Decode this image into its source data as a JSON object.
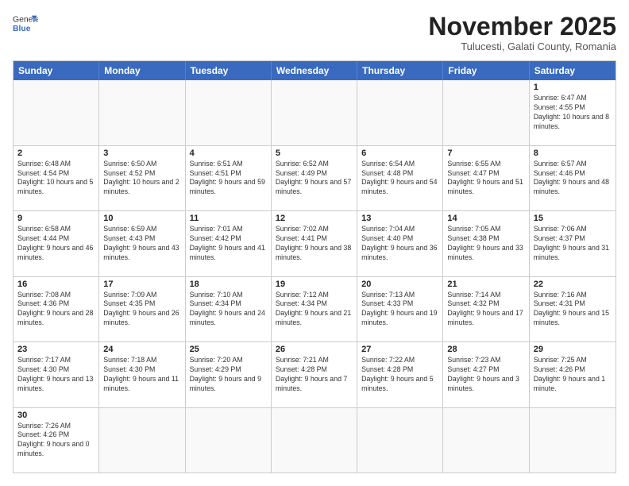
{
  "header": {
    "logo_general": "General",
    "logo_blue": "Blue",
    "month_title": "November 2025",
    "subtitle": "Tulucesti, Galati County, Romania"
  },
  "calendar": {
    "days": [
      "Sunday",
      "Monday",
      "Tuesday",
      "Wednesday",
      "Thursday",
      "Friday",
      "Saturday"
    ],
    "rows": [
      [
        {
          "day": "",
          "text": ""
        },
        {
          "day": "",
          "text": ""
        },
        {
          "day": "",
          "text": ""
        },
        {
          "day": "",
          "text": ""
        },
        {
          "day": "",
          "text": ""
        },
        {
          "day": "",
          "text": ""
        },
        {
          "day": "1",
          "text": "Sunrise: 6:47 AM\nSunset: 4:55 PM\nDaylight: 10 hours and 8 minutes."
        }
      ],
      [
        {
          "day": "2",
          "text": "Sunrise: 6:48 AM\nSunset: 4:54 PM\nDaylight: 10 hours and 5 minutes."
        },
        {
          "day": "3",
          "text": "Sunrise: 6:50 AM\nSunset: 4:52 PM\nDaylight: 10 hours and 2 minutes."
        },
        {
          "day": "4",
          "text": "Sunrise: 6:51 AM\nSunset: 4:51 PM\nDaylight: 9 hours and 59 minutes."
        },
        {
          "day": "5",
          "text": "Sunrise: 6:52 AM\nSunset: 4:49 PM\nDaylight: 9 hours and 57 minutes."
        },
        {
          "day": "6",
          "text": "Sunrise: 6:54 AM\nSunset: 4:48 PM\nDaylight: 9 hours and 54 minutes."
        },
        {
          "day": "7",
          "text": "Sunrise: 6:55 AM\nSunset: 4:47 PM\nDaylight: 9 hours and 51 minutes."
        },
        {
          "day": "8",
          "text": "Sunrise: 6:57 AM\nSunset: 4:46 PM\nDaylight: 9 hours and 48 minutes."
        }
      ],
      [
        {
          "day": "9",
          "text": "Sunrise: 6:58 AM\nSunset: 4:44 PM\nDaylight: 9 hours and 46 minutes."
        },
        {
          "day": "10",
          "text": "Sunrise: 6:59 AM\nSunset: 4:43 PM\nDaylight: 9 hours and 43 minutes."
        },
        {
          "day": "11",
          "text": "Sunrise: 7:01 AM\nSunset: 4:42 PM\nDaylight: 9 hours and 41 minutes."
        },
        {
          "day": "12",
          "text": "Sunrise: 7:02 AM\nSunset: 4:41 PM\nDaylight: 9 hours and 38 minutes."
        },
        {
          "day": "13",
          "text": "Sunrise: 7:04 AM\nSunset: 4:40 PM\nDaylight: 9 hours and 36 minutes."
        },
        {
          "day": "14",
          "text": "Sunrise: 7:05 AM\nSunset: 4:38 PM\nDaylight: 9 hours and 33 minutes."
        },
        {
          "day": "15",
          "text": "Sunrise: 7:06 AM\nSunset: 4:37 PM\nDaylight: 9 hours and 31 minutes."
        }
      ],
      [
        {
          "day": "16",
          "text": "Sunrise: 7:08 AM\nSunset: 4:36 PM\nDaylight: 9 hours and 28 minutes."
        },
        {
          "day": "17",
          "text": "Sunrise: 7:09 AM\nSunset: 4:35 PM\nDaylight: 9 hours and 26 minutes."
        },
        {
          "day": "18",
          "text": "Sunrise: 7:10 AM\nSunset: 4:34 PM\nDaylight: 9 hours and 24 minutes."
        },
        {
          "day": "19",
          "text": "Sunrise: 7:12 AM\nSunset: 4:34 PM\nDaylight: 9 hours and 21 minutes."
        },
        {
          "day": "20",
          "text": "Sunrise: 7:13 AM\nSunset: 4:33 PM\nDaylight: 9 hours and 19 minutes."
        },
        {
          "day": "21",
          "text": "Sunrise: 7:14 AM\nSunset: 4:32 PM\nDaylight: 9 hours and 17 minutes."
        },
        {
          "day": "22",
          "text": "Sunrise: 7:16 AM\nSunset: 4:31 PM\nDaylight: 9 hours and 15 minutes."
        }
      ],
      [
        {
          "day": "23",
          "text": "Sunrise: 7:17 AM\nSunset: 4:30 PM\nDaylight: 9 hours and 13 minutes."
        },
        {
          "day": "24",
          "text": "Sunrise: 7:18 AM\nSunset: 4:30 PM\nDaylight: 9 hours and 11 minutes."
        },
        {
          "day": "25",
          "text": "Sunrise: 7:20 AM\nSunset: 4:29 PM\nDaylight: 9 hours and 9 minutes."
        },
        {
          "day": "26",
          "text": "Sunrise: 7:21 AM\nSunset: 4:28 PM\nDaylight: 9 hours and 7 minutes."
        },
        {
          "day": "27",
          "text": "Sunrise: 7:22 AM\nSunset: 4:28 PM\nDaylight: 9 hours and 5 minutes."
        },
        {
          "day": "28",
          "text": "Sunrise: 7:23 AM\nSunset: 4:27 PM\nDaylight: 9 hours and 3 minutes."
        },
        {
          "day": "29",
          "text": "Sunrise: 7:25 AM\nSunset: 4:26 PM\nDaylight: 9 hours and 1 minute."
        }
      ],
      [
        {
          "day": "30",
          "text": "Sunrise: 7:26 AM\nSunset: 4:26 PM\nDaylight: 9 hours and 0 minutes."
        },
        {
          "day": "",
          "text": ""
        },
        {
          "day": "",
          "text": ""
        },
        {
          "day": "",
          "text": ""
        },
        {
          "day": "",
          "text": ""
        },
        {
          "day": "",
          "text": ""
        },
        {
          "day": "",
          "text": ""
        }
      ]
    ]
  }
}
